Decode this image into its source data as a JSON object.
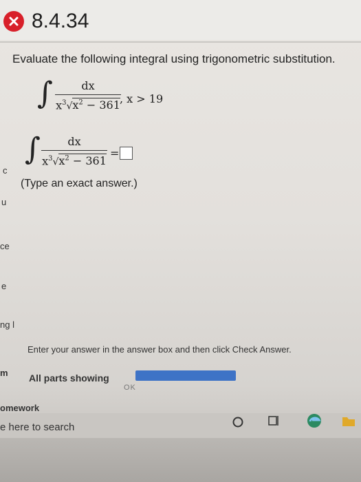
{
  "header": {
    "problem_id": "8.4.34"
  },
  "question": {
    "prompt": "Evaluate the following integral using trigonometric substitution.",
    "integrand_numerator": "dx",
    "condition": ", x > 19",
    "radicand_const": "361",
    "exponent_3": "3",
    "exponent_2": "2"
  },
  "answer": {
    "equals": "=",
    "hint": "(Type an exact answer.)"
  },
  "sidebar_fragments": [
    "c",
    "u",
    "ce",
    "e",
    "ng l"
  ],
  "footer": {
    "instructions": "Enter your answer in the answer box and then click Check Answer.",
    "parts": "All parts showing",
    "progress": 1.0,
    "ok_partial": "OK"
  },
  "taskbar": {
    "homework": "omework",
    "search": "e here to search",
    "left_clip": "m"
  },
  "colors": {
    "error": "#d8202a",
    "progress": "#3e73c6"
  }
}
